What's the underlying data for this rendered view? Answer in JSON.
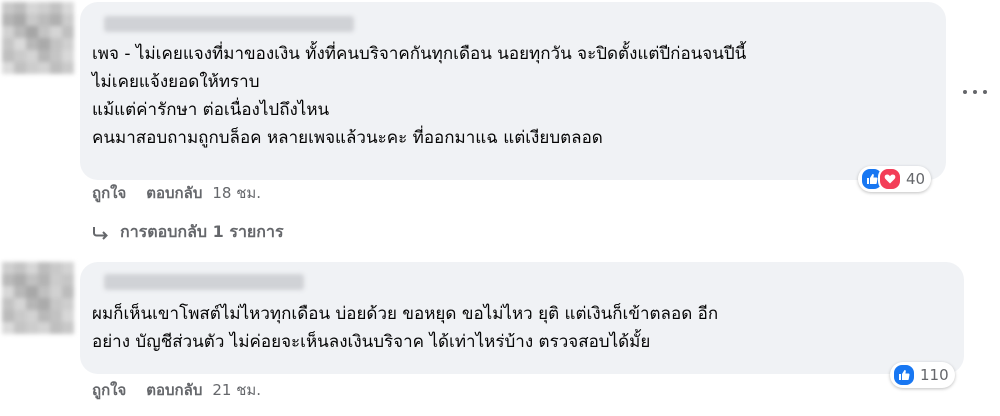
{
  "comments": [
    {
      "text": "เพจ - ไม่เคยแจงที่มาของเงิน ทั้งที่คนบริจาคกันทุกเดือน นอยทุกวัน จะปิดตั้งแต่ปีก่อนจนปีนี้\nไม่เคยแจ้งยอดให้ทราบ\nแม้แต่ค่ารักษา ต่อเนื่องไปถึงไหน\nคนมาสอบถามถูกบล็อค หลายเพจแล้วนะคะ ที่ออกมาแฉ แต่เงียบตลอด",
      "like_label": "ถูกใจ",
      "reply_label": "ตอบกลับ",
      "time": "18 ชม.",
      "reaction_count": "40",
      "reaction_types": [
        "like-icon",
        "love-icon"
      ],
      "replies_label": "การตอบกลับ 1 รายการ"
    },
    {
      "text": "ผมก็เห็นเขาโพสต์ไม่ไหวทุกเดือน บ่อยด้วย ขอหยุด ขอไม่ไหว ยุติ แต่เงินก็เข้าตลอด อีก\nอย่าง บัญชีส่วนตัว ไม่ค่อยจะเห็นลงเงินบริจาค ได้เท่าไหร่บ้าง ตรวจสอบได้มั้ย",
      "like_label": "ถูกใจ",
      "reply_label": "ตอบกลับ",
      "time": "21 ชม.",
      "reaction_count": "110",
      "reaction_types": [
        "like-icon"
      ]
    }
  ],
  "colors": {
    "bubble": "#f0f2f5",
    "meta_text": "#65676b",
    "like_blue": "#1877f2",
    "love_red": "#f33e58"
  }
}
